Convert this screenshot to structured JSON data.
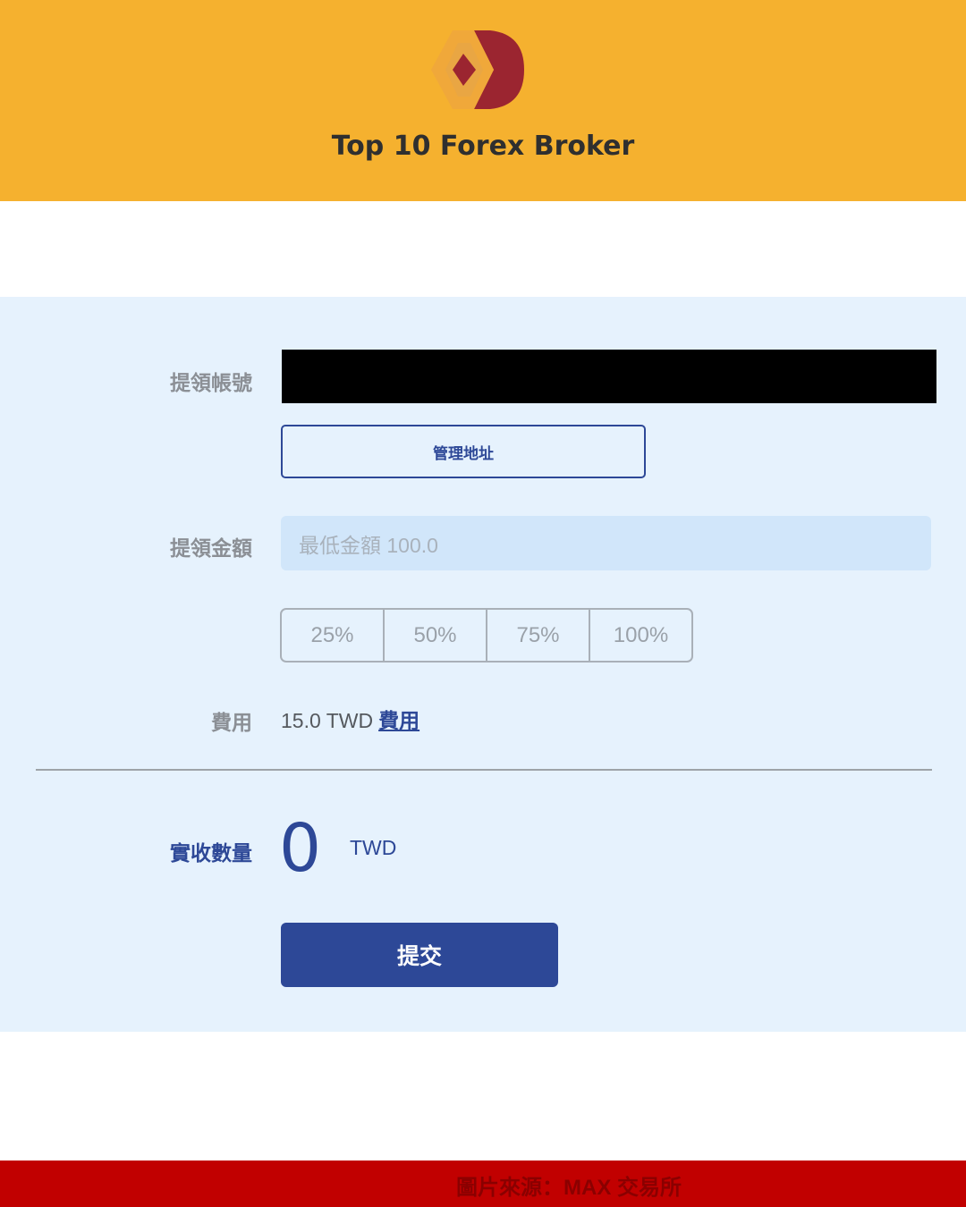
{
  "header": {
    "brand": "Top 10 Forex Broker",
    "colors": {
      "background": "#f5b12f",
      "logo_dark_red": "#9b2530",
      "logo_gold": "#f0a83a"
    }
  },
  "form": {
    "account_label": "提領帳號",
    "manage_address_label": "管理地址",
    "amount_label": "提領金額",
    "amount_placeholder": "最低金額 100.0",
    "amount_value": "",
    "percent_options": [
      "25%",
      "50%",
      "75%",
      "100%"
    ],
    "fee_label": "費用",
    "fee_value": "15.0 TWD",
    "fee_link": "費用",
    "received_label": "實收數量",
    "received_amount": "0",
    "received_unit": "TWD",
    "submit_label": "提交",
    "colors": {
      "panel": "#e6f2fd",
      "accent": "#2d4897",
      "input": "#d1e6fa"
    }
  },
  "footer": {
    "source_text": "圖片來源：MAX 交易所",
    "colors": {
      "background": "#c10000"
    }
  }
}
